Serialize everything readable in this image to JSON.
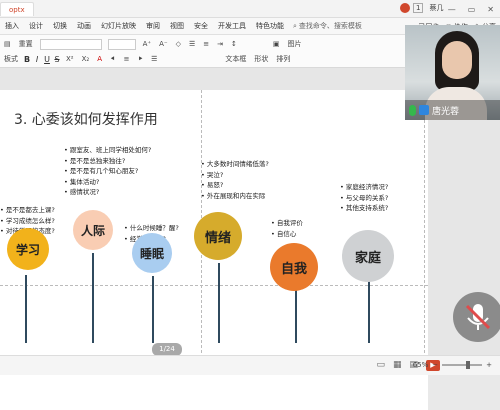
{
  "titlebar": {
    "file_tab": "optx",
    "user_name": "蔡几",
    "page_badge": "1",
    "win_controls": [
      "—",
      "▭",
      "✕"
    ]
  },
  "menubar": {
    "items": [
      "插入",
      "设计",
      "切换",
      "动画",
      "幻灯片放映",
      "审阅",
      "视图",
      "安全",
      "开发工具",
      "特色功能"
    ],
    "search_placeholder": "查找命令、搜索模板",
    "sync_label": "已同步",
    "collab_label": "协作",
    "share_label": "分享"
  },
  "toolbar": {
    "row1": [
      "重置"
    ],
    "row2_left": "板式",
    "text_box": "文本框",
    "shape": "形状",
    "arrange": "排列",
    "picture": "图片",
    "fmt_bold": "B",
    "fmt_italic": "I",
    "fmt_underline": "U",
    "fmt_strike": "S"
  },
  "slide": {
    "title": "3. 心委该如何发挥作用",
    "page_indicator": "1/24",
    "groups": [
      {
        "label": "学习",
        "color": "#f2b21b",
        "bullets": [
          "是不是都去上课?",
          "学习成绩怎么样?",
          "对待学习的态度?"
        ]
      },
      {
        "label": "人际",
        "color": "#f9cdb3",
        "bullets": [
          "跟室友、班上同学相处如何?",
          "是不是总独来独往?",
          "是不是有几个知心朋友?",
          "集体活动?",
          "感情状况?"
        ]
      },
      {
        "label": "睡眠",
        "color": "#a9cdf0",
        "bullets": [
          "什么时候睡？醒?",
          "经常睡不着?"
        ]
      },
      {
        "label": "情绪",
        "color": "#d6ab2c",
        "bullets": [
          "大多数时间情绪低落?",
          "哭泣?",
          "易怒?",
          "外在展现和内在实际"
        ]
      },
      {
        "label": "自我",
        "color": "#ea7a2c",
        "bullets": [
          "自我评价",
          "自信心"
        ]
      },
      {
        "label": "家庭",
        "color": "#cfd1d3",
        "bullets": [
          "家庭经济情况?",
          "与父母的关系?",
          "其他支持系统?"
        ]
      }
    ]
  },
  "video": {
    "participant_name": "唐光蓉",
    "mic_state": "on"
  },
  "statusbar": {
    "zoom": "65%"
  },
  "colors": {
    "accent": "#d0472c",
    "trunk": "#2f4a5e"
  }
}
